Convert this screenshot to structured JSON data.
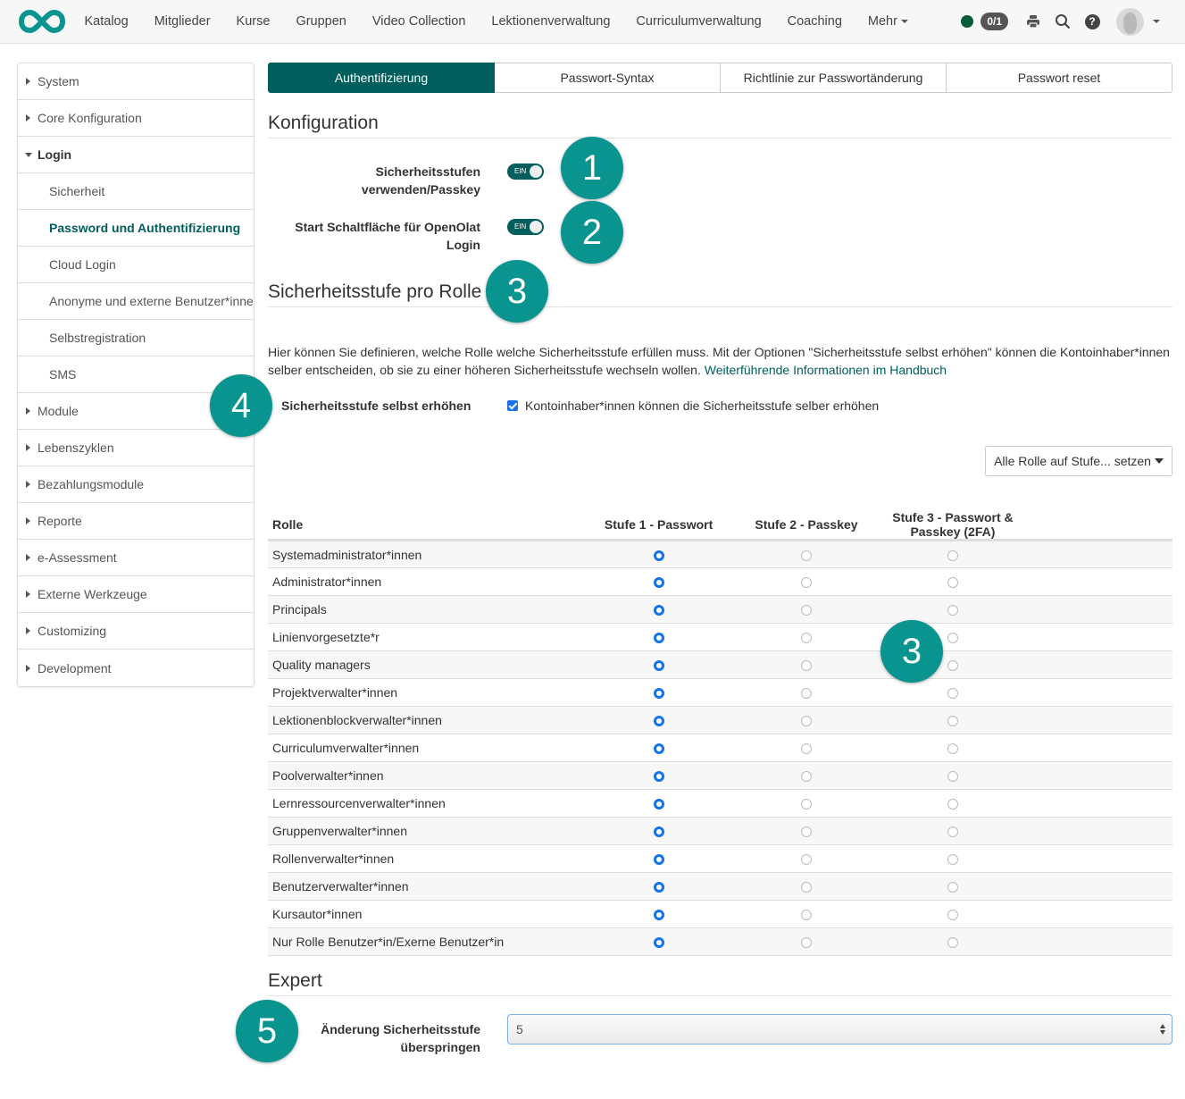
{
  "topbar": {
    "logo": "openolat-infinity-logo",
    "nav": [
      "Katalog",
      "Mitglieder",
      "Kurse",
      "Gruppen",
      "Video Collection",
      "Lektionenverwaltung",
      "Curriculumverwaltung",
      "Coaching"
    ],
    "more_label": "Mehr",
    "badge": "0/1",
    "status_color": "#0b5c36",
    "icons": [
      "status-dot",
      "print-icon",
      "search-icon",
      "help-icon",
      "avatar"
    ]
  },
  "sidebar": {
    "items": [
      {
        "label": "System",
        "type": "collapsed"
      },
      {
        "label": "Core Konfiguration",
        "type": "collapsed"
      },
      {
        "label": "Login",
        "type": "expanded"
      },
      {
        "label": "Sicherheit",
        "type": "sub"
      },
      {
        "label": "Password und Authentifizierung",
        "type": "sub-active"
      },
      {
        "label": "Cloud Login",
        "type": "sub"
      },
      {
        "label": "Anonyme und externe Benutzer*innen",
        "type": "sub"
      },
      {
        "label": "Selbstregistration",
        "type": "sub"
      },
      {
        "label": "SMS",
        "type": "sub"
      },
      {
        "label": "Module",
        "type": "collapsed"
      },
      {
        "label": "Lebenszyklen",
        "type": "collapsed"
      },
      {
        "label": "Bezahlungsmodule",
        "type": "collapsed"
      },
      {
        "label": "Reporte",
        "type": "collapsed"
      },
      {
        "label": "e-Assessment",
        "type": "collapsed"
      },
      {
        "label": "Externe Werkzeuge",
        "type": "collapsed"
      },
      {
        "label": "Customizing",
        "type": "collapsed"
      },
      {
        "label": "Development",
        "type": "collapsed"
      }
    ]
  },
  "tabs": [
    {
      "label": "Authentifizierung",
      "active": true
    },
    {
      "label": "Passwort-Syntax",
      "active": false
    },
    {
      "label": "Richtlinie zur Passwortänderung",
      "active": false
    },
    {
      "label": "Passwort reset",
      "active": false
    }
  ],
  "konfiguration": {
    "title": "Konfiguration",
    "toggle1_label_line1": "Sicherheitsstufen",
    "toggle1_label_line2": "verwenden/Passkey",
    "toggle1_state": "EIN",
    "toggle2_label_line1": "Start Schaltfläche für OpenOlat",
    "toggle2_label_line2": "Login",
    "toggle2_state": "EIN"
  },
  "rolle_section": {
    "title": "Sicherheitsstufe pro Rolle",
    "description": "Hier können Sie definieren, welche Rolle welche Sicherheitsstufe erfüllen muss. Mit der Optionen \"Sicherheitsstufe selbst erhöhen\" können die Kontoinhaber*innen selber entscheiden, ob sie zu einer höheren Sicherheitsstufe wechseln wollen.",
    "link": "Weiterführende Informationen im Handbuch",
    "self_raise_label": "Sicherheitsstufe selbst erhöhen",
    "self_raise_checkbox": "Kontoinhaber*innen können die Sicherheitsstufe selber erhöhen",
    "self_raise_checked": true,
    "set_all_button": "Alle Rolle auf Stufe... setzen"
  },
  "table": {
    "headers": [
      "Rolle",
      "Stufe 1 - Passwort",
      "Stufe 2 - Passkey",
      "Stufe 3 - Passwort & Passkey (2FA)"
    ],
    "rows": [
      {
        "role": "Systemadministrator*innen",
        "level": 1
      },
      {
        "role": "Administrator*innen",
        "level": 1
      },
      {
        "role": "Principals",
        "level": 1
      },
      {
        "role": "Linienvorgesetzte*r",
        "level": 1
      },
      {
        "role": "Quality managers",
        "level": 1
      },
      {
        "role": "Projektverwalter*innen",
        "level": 1
      },
      {
        "role": "Lektionenblockverwalter*innen",
        "level": 1
      },
      {
        "role": "Curriculumverwalter*innen",
        "level": 1
      },
      {
        "role": "Poolverwalter*innen",
        "level": 1
      },
      {
        "role": "Lernressourcenverwalter*innen",
        "level": 1
      },
      {
        "role": "Gruppenverwalter*innen",
        "level": 1
      },
      {
        "role": "Rollenverwalter*innen",
        "level": 1
      },
      {
        "role": "Benutzerverwalter*innen",
        "level": 1
      },
      {
        "role": "Kursautor*innen",
        "level": 1
      },
      {
        "role": "Nur Rolle Benutzer*in/Exerne Benutzer*in",
        "level": 1
      }
    ]
  },
  "expert": {
    "title": "Expert",
    "label_line1": "Änderung Sicherheitsstufe",
    "label_line2": "überspringen",
    "select_value": "5"
  },
  "callouts": [
    "1",
    "2",
    "3",
    "4",
    "3",
    "5"
  ],
  "colors": {
    "brand": "#005e5d",
    "callout": "#0a9490",
    "radio": "#1473e6"
  }
}
